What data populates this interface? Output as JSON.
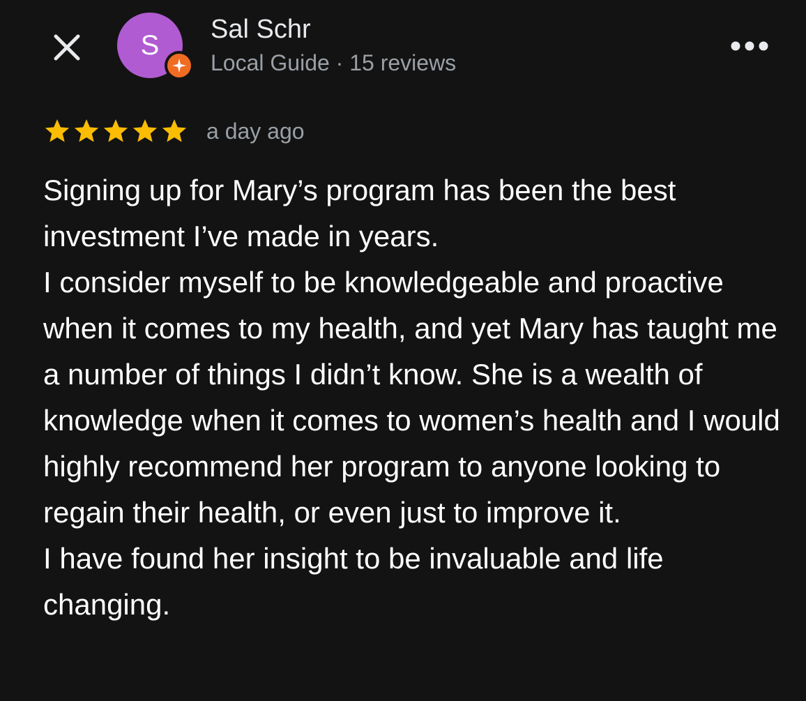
{
  "header": {
    "close_icon": "close-icon",
    "more_icon": "more-horizontal-icon",
    "avatar_letter": "S",
    "avatar_color": "#b05bd1",
    "badge_color": "#f06c22",
    "badge_icon": "local-guide-badge-icon",
    "user_name": "Sal Schr",
    "user_meta": "Local Guide · 15 reviews"
  },
  "review": {
    "rating": 5,
    "rating_max": 5,
    "star_color": "#fbbc04",
    "time_ago": "a day ago",
    "paragraphs": [
      "Signing up for Mary’s program has been the best investment I’ve made in years.",
      "I consider myself to be knowledgeable and proactive when it comes to my health, and yet Mary has taught me a number of things I didn’t know. She is a wealth of knowledge when it comes to women’s health and I would highly recommend her program to anyone looking to regain their health, or even just to improve it.",
      "I have found her insight to be invaluable and life changing."
    ]
  }
}
